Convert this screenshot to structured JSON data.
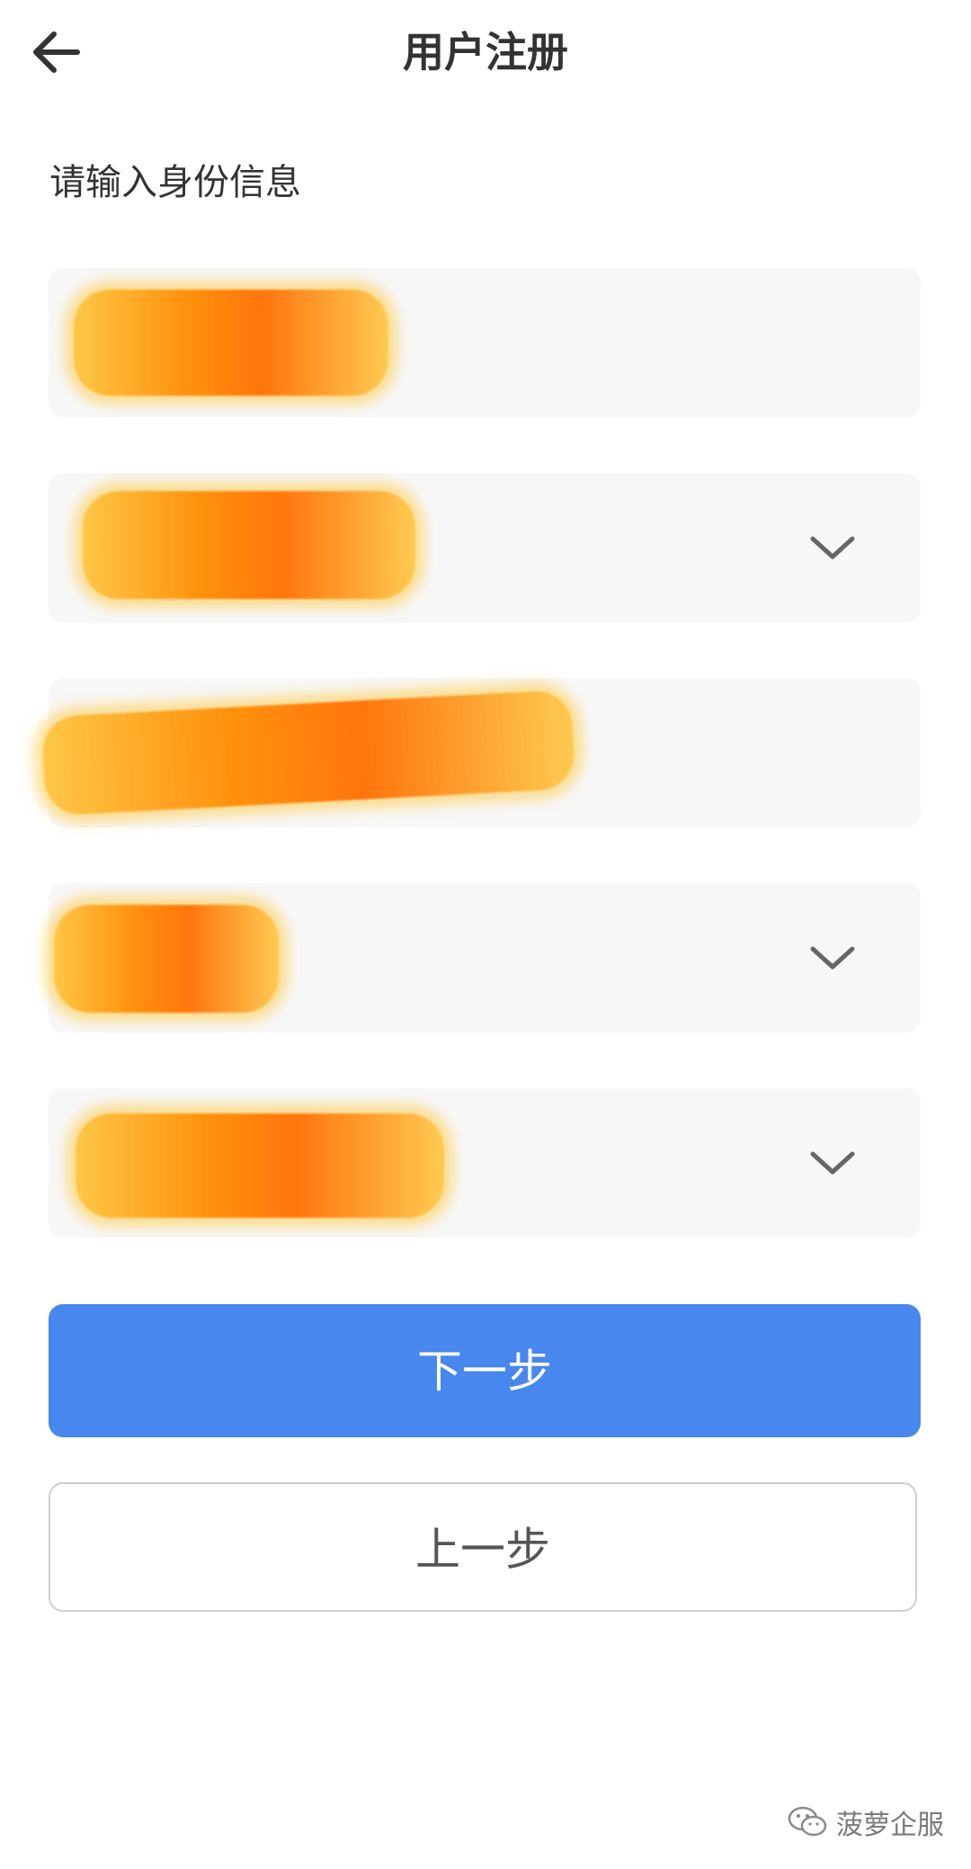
{
  "header": {
    "title": "用户注册",
    "back_icon": "arrow-left-icon"
  },
  "form": {
    "section_label": "请输入身份信息",
    "fields": [
      {
        "value": "",
        "type": "input",
        "redacted": true
      },
      {
        "value": "",
        "type": "select",
        "redacted": true,
        "icon": "chevron-down-icon"
      },
      {
        "value": "",
        "type": "input",
        "redacted": true
      },
      {
        "value": "",
        "type": "select",
        "redacted": true,
        "icon": "chevron-down-icon"
      },
      {
        "value": "",
        "type": "select",
        "redacted": true,
        "icon": "chevron-down-icon"
      }
    ]
  },
  "actions": {
    "next_label": "下一步",
    "prev_label": "上一步"
  },
  "colors": {
    "primary": "#4787ee",
    "field_bg": "#f7f7f7",
    "redaction": "#ff8c00"
  },
  "watermark": {
    "text": "菠萝企服",
    "icon": "wechat-icon"
  }
}
